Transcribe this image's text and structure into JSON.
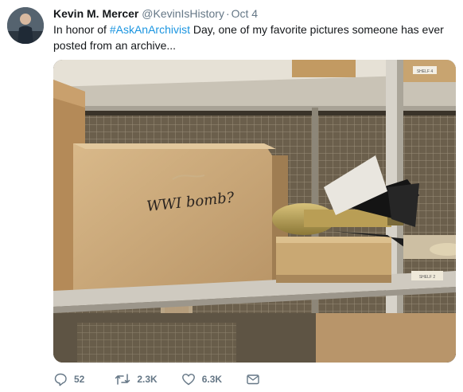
{
  "tweet": {
    "author_name": "Kevin M. Mercer",
    "handle": "@KevinIsHistory",
    "separator": "·",
    "timestamp": "Oct 4",
    "text_before": "In honor of ",
    "hashtag": "#AskAnArchivist",
    "text_after": " Day, one of my favorite pictures someone has ever posted from an archive...",
    "image": {
      "box_label": "WWI bomb?",
      "label_right": "SHELF 2",
      "label_top": "SHELF 4"
    }
  },
  "actions": {
    "reply_count": "52",
    "retweet_count": "2.3K",
    "like_count": "6.3K"
  },
  "colors": {
    "link": "#1b95e0",
    "muted": "#657786",
    "text": "#14171a"
  },
  "icons": [
    "reply-icon",
    "retweet-icon",
    "like-icon",
    "message-icon"
  ]
}
